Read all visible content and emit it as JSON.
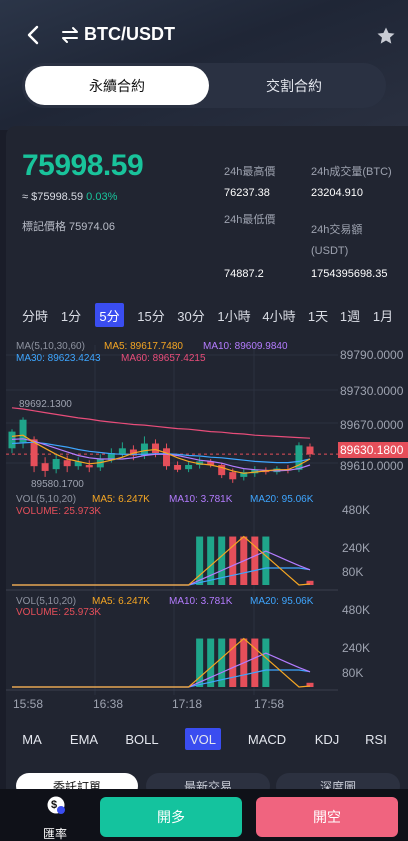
{
  "header": {
    "title": "BTC/USDT"
  },
  "segments": [
    "永續合約",
    "交割合約"
  ],
  "ticker": {
    "price": "75998.59",
    "sub_price": "≈ $75998.59",
    "change_pct": "0.03%",
    "mark_label": "標記價格 75974.06",
    "high_label": "24h最高價",
    "high_value": "76237.38",
    "low_label": "24h最低價",
    "low_value": "74887.2",
    "vol_btc_label": "24h成交量(BTC)",
    "vol_btc_value": "23204.910",
    "vol_usdt_label": "24h交易額",
    "vol_usdt_unit": "(USDT)",
    "vol_usdt_value": "1754395698.35"
  },
  "intervals": [
    "分時",
    "1分",
    "5分",
    "15分",
    "30分",
    "1小時",
    "4小時",
    "1天",
    "1週",
    "1月"
  ],
  "active_interval": "5分",
  "main_legend": {
    "ma_params": "MA(5,10,30,60)",
    "ma5": "MA5: 89617.7480",
    "ma10": "MA10: 89609.9840",
    "ma30": "MA30: 89623.4243",
    "ma60": "MA60: 89657.4215"
  },
  "price_axis": [
    "89790.0000",
    "89730.0000",
    "89670.0000",
    "89610.0000"
  ],
  "current_price_tag": "89630.1800",
  "high_marker": "89692.1300",
  "low_marker": "89580.1700",
  "vol_legend": {
    "params": "VOL(5,10,20)",
    "ma5": "MA5: 6.247K",
    "ma10": "MA10: 3.781K",
    "ma20": "MA20: 95.06K",
    "volume": "VOLUME: 25.973K"
  },
  "vol_axis": [
    "480K",
    "240K",
    "80K"
  ],
  "time_axis": [
    "15:58",
    "16:38",
    "17:18",
    "17:58"
  ],
  "indicators": [
    "MA",
    "EMA",
    "BOLL",
    "VOL",
    "MACD",
    "KDJ",
    "RSI"
  ],
  "active_indicator": "VOL",
  "bottom_tabs": [
    "委託訂單",
    "最新交易",
    "深度圖"
  ],
  "bottom": {
    "rate_label": "匯率",
    "rate_icon": "$",
    "long": "開多",
    "short": "開空"
  },
  "chart_data": {
    "type": "candlestick",
    "ylim": [
      89570,
      89800
    ],
    "candles": [
      {
        "o": 89640,
        "c": 89668,
        "h": 89672,
        "l": 89632
      },
      {
        "o": 89650,
        "c": 89688,
        "h": 89692,
        "l": 89640
      },
      {
        "o": 89655,
        "c": 89610,
        "h": 89660,
        "l": 89600
      },
      {
        "o": 89615,
        "c": 89602,
        "h": 89625,
        "l": 89592
      },
      {
        "o": 89605,
        "c": 89622,
        "h": 89630,
        "l": 89598
      },
      {
        "o": 89620,
        "c": 89610,
        "h": 89628,
        "l": 89600
      },
      {
        "o": 89610,
        "c": 89618,
        "h": 89625,
        "l": 89604
      },
      {
        "o": 89612,
        "c": 89608,
        "h": 89620,
        "l": 89600
      },
      {
        "o": 89608,
        "c": 89622,
        "h": 89630,
        "l": 89602
      },
      {
        "o": 89620,
        "c": 89632,
        "h": 89640,
        "l": 89616
      },
      {
        "o": 89630,
        "c": 89640,
        "h": 89650,
        "l": 89624
      },
      {
        "o": 89638,
        "c": 89628,
        "h": 89645,
        "l": 89620
      },
      {
        "o": 89628,
        "c": 89648,
        "h": 89660,
        "l": 89622
      },
      {
        "o": 89648,
        "c": 89632,
        "h": 89655,
        "l": 89625
      },
      {
        "o": 89640,
        "c": 89610,
        "h": 89648,
        "l": 89604
      },
      {
        "o": 89612,
        "c": 89604,
        "h": 89618,
        "l": 89600
      },
      {
        "o": 89605,
        "c": 89612,
        "h": 89618,
        "l": 89600
      },
      {
        "o": 89612,
        "c": 89618,
        "h": 89625,
        "l": 89606
      },
      {
        "o": 89618,
        "c": 89612,
        "h": 89622,
        "l": 89608
      },
      {
        "o": 89612,
        "c": 89595,
        "h": 89616,
        "l": 89590
      },
      {
        "o": 89600,
        "c": 89588,
        "h": 89606,
        "l": 89582
      },
      {
        "o": 89592,
        "c": 89600,
        "h": 89605,
        "l": 89586
      },
      {
        "o": 89598,
        "c": 89604,
        "h": 89610,
        "l": 89592
      },
      {
        "o": 89603,
        "c": 89600,
        "h": 89608,
        "l": 89596
      },
      {
        "o": 89600,
        "c": 89606,
        "h": 89610,
        "l": 89596
      },
      {
        "o": 89605,
        "c": 89603,
        "h": 89612,
        "l": 89598
      },
      {
        "o": 89604,
        "c": 89645,
        "h": 89650,
        "l": 89600
      },
      {
        "o": 89643,
        "c": 89630,
        "h": 89648,
        "l": 89625
      }
    ],
    "ma_lines": {
      "MA5": [
        89660,
        89662,
        89650,
        89640,
        89630,
        89622,
        89618,
        89614,
        89616,
        89620,
        89625,
        89632,
        89636,
        89638,
        89632,
        89624,
        89618,
        89614,
        89612,
        89608,
        89602,
        89598,
        89600,
        89602,
        89604,
        89604,
        89612,
        89622
      ],
      "MA10": [
        89655,
        89656,
        89652,
        89646,
        89640,
        89634,
        89628,
        89624,
        89622,
        89622,
        89622,
        89624,
        89628,
        89630,
        89630,
        89628,
        89624,
        89620,
        89618,
        89615,
        89610,
        89606,
        89604,
        89603,
        89602,
        89603,
        89606,
        89612
      ],
      "MA30": [
        89648,
        89649,
        89650,
        89648,
        89645,
        89642,
        89638,
        89635,
        89633,
        89631,
        89630,
        89630,
        89630,
        89631,
        89631,
        89630,
        89628,
        89627,
        89625,
        89624,
        89622,
        89620,
        89618,
        89617,
        89616,
        89616,
        89618,
        89622
      ],
      "MA60": [
        89708,
        89706,
        89703,
        89700,
        89697,
        89694,
        89691,
        89689,
        89686,
        89684,
        89682,
        89680,
        89679,
        89677,
        89675,
        89673,
        89672,
        89670,
        89668,
        89667,
        89665,
        89664,
        89662,
        89661,
        89660,
        89659,
        89658,
        89657
      ]
    },
    "volume": {
      "ylim": [
        0,
        520
      ],
      "values": [
        0,
        0,
        0,
        0,
        0,
        0,
        0,
        0,
        0,
        0,
        0,
        0,
        0,
        0,
        0,
        0,
        0,
        300,
        300,
        300,
        300,
        300,
        300,
        300,
        0,
        0,
        0,
        26
      ],
      "up": [
        1,
        1,
        0,
        0,
        1,
        0,
        1,
        0,
        1,
        1,
        1,
        0,
        1,
        0,
        0,
        0,
        1,
        1,
        1,
        1,
        0,
        0,
        0,
        1,
        1,
        0,
        1,
        0
      ],
      "MA5": [
        0,
        0,
        0,
        0,
        0,
        0,
        0,
        0,
        0,
        0,
        0,
        0,
        0,
        0,
        0,
        0,
        0,
        60,
        120,
        180,
        240,
        300,
        240,
        180,
        120,
        60,
        0,
        6
      ],
      "MA10": [
        0,
        0,
        0,
        0,
        0,
        0,
        0,
        0,
        0,
        0,
        0,
        0,
        0,
        0,
        0,
        0,
        0,
        30,
        60,
        90,
        120,
        150,
        180,
        210,
        180,
        150,
        120,
        94
      ],
      "MA20": [
        0,
        0,
        0,
        0,
        0,
        0,
        0,
        0,
        0,
        0,
        0,
        0,
        0,
        0,
        0,
        0,
        0,
        15,
        30,
        45,
        60,
        75,
        90,
        105,
        105,
        105,
        105,
        95
      ]
    }
  }
}
